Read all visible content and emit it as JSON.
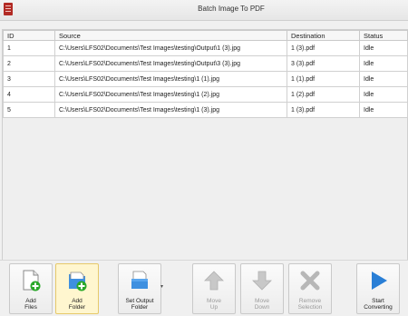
{
  "window": {
    "title": "Batch Image To PDF"
  },
  "table": {
    "headers": [
      "ID",
      "Source",
      "Destination",
      "Status"
    ],
    "rows": [
      {
        "id": "1",
        "source": "C:\\Users\\LFS02\\Documents\\Test Images\\testing\\Output\\1 (3).jpg",
        "destination": "1 (3).pdf",
        "status": "Idle"
      },
      {
        "id": "2",
        "source": "C:\\Users\\LFS02\\Documents\\Test Images\\testing\\Output\\3 (3).jpg",
        "destination": "3 (3).pdf",
        "status": "Idle"
      },
      {
        "id": "3",
        "source": "C:\\Users\\LFS02\\Documents\\Test Images\\testing\\1 (1).jpg",
        "destination": "1 (1).pdf",
        "status": "Idle"
      },
      {
        "id": "4",
        "source": "C:\\Users\\LFS02\\Documents\\Test Images\\testing\\1 (2).jpg",
        "destination": "1 (2).pdf",
        "status": "Idle"
      },
      {
        "id": "5",
        "source": "C:\\Users\\LFS02\\Documents\\Test Images\\testing\\1 (3).jpg",
        "destination": "1 (3).pdf",
        "status": "Idle"
      }
    ]
  },
  "toolbar": {
    "add_files": {
      "line1": "Add",
      "line2": "Files",
      "icon": "add-file-icon"
    },
    "add_folder": {
      "line1": "Add",
      "line2": "Folder",
      "icon": "add-folder-icon"
    },
    "set_output": {
      "line1": "Set Output",
      "line2": "Folder",
      "icon": "output-folder-icon"
    },
    "move_up": {
      "line1": "Move",
      "line2": "Up",
      "icon": "arrow-up-icon"
    },
    "move_down": {
      "line1": "Move",
      "line2": "Down",
      "icon": "arrow-down-icon"
    },
    "remove": {
      "line1": "Remove",
      "line2": "Selection",
      "icon": "remove-icon"
    },
    "start": {
      "line1": "Start",
      "line2": "Converting",
      "icon": "play-icon"
    }
  },
  "colors": {
    "accent_blue": "#2a7fd6",
    "add_green": "#2aa82a",
    "disabled_gray": "#c8c8c8",
    "remove_gray": "#b7b7b7"
  }
}
